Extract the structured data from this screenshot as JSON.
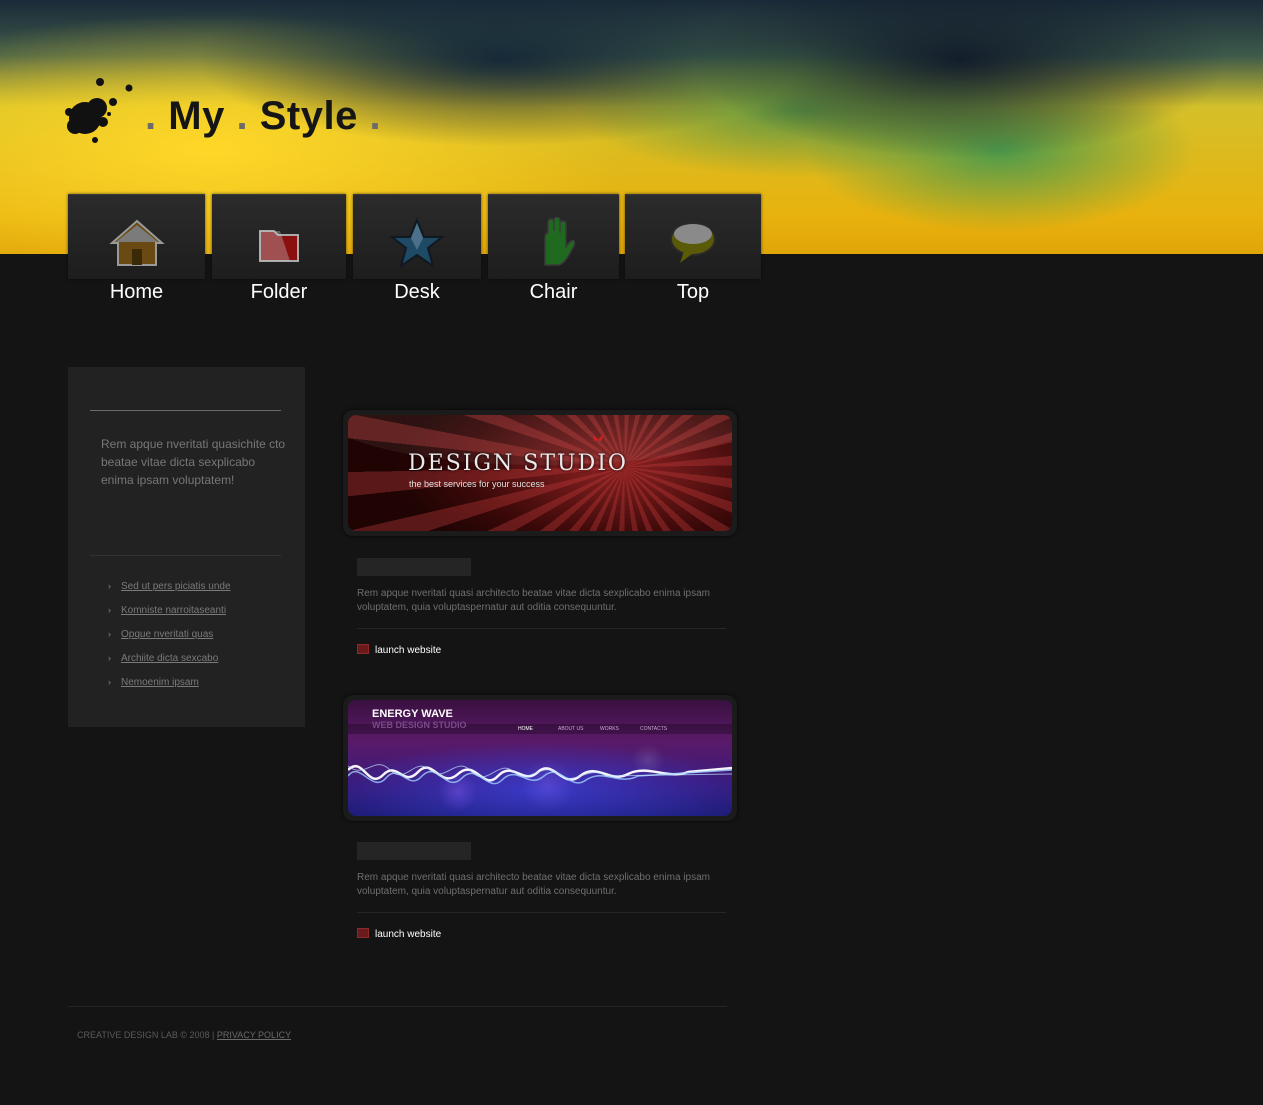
{
  "site": {
    "title_words": [
      "My",
      "Style"
    ],
    "title_dot": "."
  },
  "nav": {
    "items": [
      {
        "label": "Home",
        "icon": "home-icon"
      },
      {
        "label": "Folder",
        "icon": "folder-icon"
      },
      {
        "label": "Desk",
        "icon": "star-icon"
      },
      {
        "label": "Chair",
        "icon": "hand-icon"
      },
      {
        "label": "Top",
        "icon": "speech-bubble-icon"
      }
    ]
  },
  "sidebar": {
    "intro": "Rem apque nveritati quasichite cto beatae vitae dicta sexplicabo enima ipsam voluptatem!",
    "arrow": "›",
    "links": [
      "Sed ut pers piciatis unde",
      "Komniste narroitaseanti",
      "Opque nveritati quas",
      "Archiite dicta sexcabo",
      "Nemoenim ipsam"
    ]
  },
  "projects": [
    {
      "banner_title": "DESIGN STUDIO",
      "banner_subtitle": "the best services for your success",
      "text": "Rem apque nveritati quasi architecto beatae vitae dicta sexplicabo enima ipsam voluptatem, quia voluptaspernatur aut oditia consequuntur.",
      "link": "launch website"
    },
    {
      "banner_title": "ENERGY WAVE",
      "banner_subtitle": "WEB DESIGN STUDIO",
      "banner_menu": [
        "HOME",
        "ABOUT US",
        "WORKS",
        "CONTACTS"
      ],
      "text": "Rem apque nveritati quasi architecto beatae vitae dicta sexplicabo enima ipsam voluptatem, quia voluptaspernatur aut oditia consequuntur.",
      "link": "launch website"
    }
  ],
  "footer": {
    "copyright": "CREATIVE DESIGN LAB © 2008 |",
    "privacy": "PRIVACY POLICY"
  },
  "colors": {
    "header_yellow": "#e8b20e",
    "background": "#141414",
    "sidebar_bg": "#222222"
  }
}
